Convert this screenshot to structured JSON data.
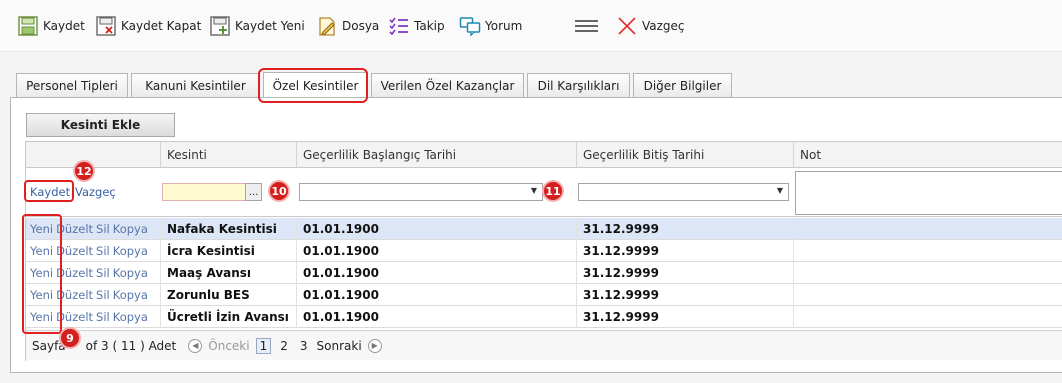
{
  "toolbar": {
    "kaydet": "Kaydet",
    "kaydet_kapat": "Kaydet Kapat",
    "kaydet_yeni": "Kaydet Yeni",
    "dosya": "Dosya",
    "takip": "Takip",
    "yorum": "Yorum",
    "vazgec": "Vazgeç"
  },
  "tabs": [
    "Personel Tipleri",
    "Kanuni Kesintiler",
    "Özel Kesintiler",
    "Verilen Özel Kazançlar",
    "Dil Karşılıkları",
    "Diğer Bilgiler"
  ],
  "add_button": "Kesinti Ekle",
  "grid": {
    "columns": [
      "",
      "Kesinti",
      "Geçerlilik Başlangıç Tarihi",
      "Geçerlilik Bitiş Tarihi",
      "Not"
    ],
    "edit_row": {
      "save": "Kaydet",
      "cancel": "Vazgeç",
      "lookup": "..."
    },
    "actions": {
      "new": "Yeni",
      "edit": "Düzelt",
      "delete": "Sil",
      "copy": "Kopya"
    },
    "rows": [
      {
        "kesinti": "Nafaka Kesintisi",
        "baslangic": "01.01.1900",
        "bitis": "31.12.9999",
        "not": ""
      },
      {
        "kesinti": "İcra Kesintisi",
        "baslangic": "01.01.1900",
        "bitis": "31.12.9999",
        "not": ""
      },
      {
        "kesinti": "Maaş Avansı",
        "baslangic": "01.01.1900",
        "bitis": "31.12.9999",
        "not": ""
      },
      {
        "kesinti": "Zorunlu BES",
        "baslangic": "01.01.1900",
        "bitis": "31.12.9999",
        "not": ""
      },
      {
        "kesinti": "Ücretli İzin Avansı",
        "baslangic": "01.01.1900",
        "bitis": "31.12.9999",
        "not": ""
      }
    ]
  },
  "pager": {
    "sayfa": "Sayfa",
    "of_text": "of 3 ( 11 ) Adet",
    "prev": "Önceki",
    "pages": [
      "1",
      "2",
      "3"
    ],
    "next": "Sonraki"
  },
  "annotations": {
    "b9": "9",
    "b10": "10",
    "b11": "11",
    "b12": "12"
  },
  "colors": {
    "highlight": "#e02020",
    "link": "#3a5fa0",
    "selected_row": "#dde6f6"
  }
}
